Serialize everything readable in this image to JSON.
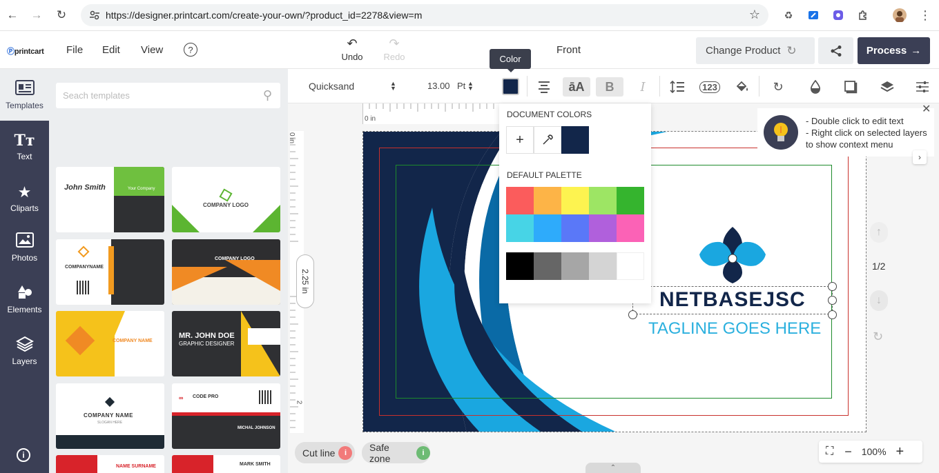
{
  "browser": {
    "url": "https://designer.printcart.com/create-your-own/?product_id=2278&view=m"
  },
  "header": {
    "logo": "printcart",
    "menu": [
      "File",
      "Edit",
      "View"
    ],
    "undo_label": "Undo",
    "redo_label": "Redo",
    "view_name": "Front",
    "color_tooltip": "Color",
    "change_product_label": "Change Product",
    "process_label": "Process"
  },
  "sidebar": {
    "items": [
      {
        "label": "Templates",
        "icon": "templates-icon"
      },
      {
        "label": "Text",
        "icon": "text-icon"
      },
      {
        "label": "Cliparts",
        "icon": "star-icon"
      },
      {
        "label": "Photos",
        "icon": "photo-icon"
      },
      {
        "label": "Elements",
        "icon": "shapes-icon"
      },
      {
        "label": "Layers",
        "icon": "layers-icon"
      }
    ]
  },
  "templates": {
    "search_placeholder": "Seach templates",
    "cards": [
      {
        "text": "John Smith",
        "sub": "Your Company"
      },
      {
        "text": "COMPANY LOGO"
      },
      {
        "text": "COMPANYNAME"
      },
      {
        "text": "COMPANY LOGO"
      },
      {
        "text": "COMPANY NAME"
      },
      {
        "text": "MR. JOHN DOE",
        "sub": "GRAPHIC DESIGNER"
      },
      {
        "text": "COMPANY NAME",
        "sub": "SLOGAN HERE"
      },
      {
        "text": "CODE PRO",
        "sub": "MICHAL JOHNSON"
      },
      {
        "text": "NAME SURNAME"
      },
      {
        "text": "MARK SMITH"
      }
    ]
  },
  "toolbar": {
    "font_name": "Quicksand",
    "font_size": "13.00",
    "font_unit": "Pt",
    "current_color": "#12264a",
    "numbers_icon": "123"
  },
  "canvas": {
    "ruler_top_label": "0 in",
    "ruler_left_label": "0 in",
    "ruler_left_mark": "2",
    "height_label": "2.25 in",
    "brand": "NETBASEJSC",
    "tagline": "TAGLINE GOES HERE",
    "colors": {
      "navy": "#12264a",
      "cyan": "#1aa7e0",
      "blue": "#0a6aa6"
    }
  },
  "color_popup": {
    "document_title": "DOCUMENT COLORS",
    "palette_title": "DEFAULT PALETTE",
    "document_colors": [
      "#12264a"
    ],
    "palette_row1": [
      "#fb5c5c",
      "#fdb447",
      "#fdf350",
      "#9de564",
      "#35b42e"
    ],
    "palette_row2": [
      "#47d4e6",
      "#2eabfb",
      "#5a78f8",
      "#b060dc",
      "#fb62b6"
    ],
    "palette_row3": [
      "#000000",
      "#666666",
      "#a6a6a6",
      "#d4d4d4",
      "#ffffff"
    ]
  },
  "hint": {
    "line1": "- Double click to edit text",
    "line2": "- Right click on selected layers",
    "line3": "to show context menu"
  },
  "pages": {
    "counter": "1/2"
  },
  "footer": {
    "cut_line_label": "Cut line",
    "safe_zone_label": "Safe zone",
    "zoom_level": "100%"
  }
}
